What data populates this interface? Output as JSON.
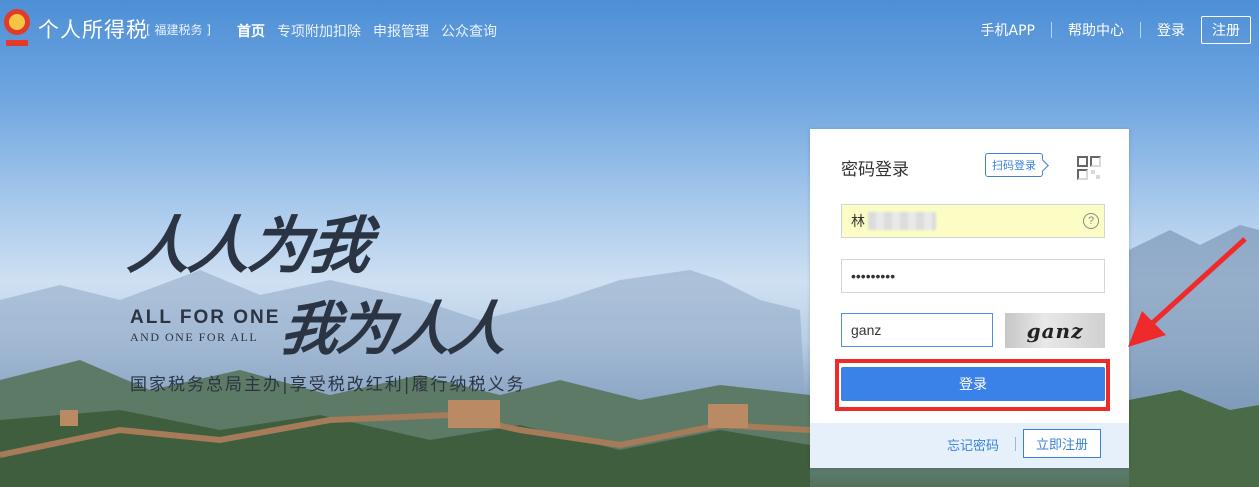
{
  "header": {
    "brand_title": "个人所得税",
    "brand_region": "[ 福建税务 ]",
    "nav": [
      {
        "label": "首页",
        "active": true
      },
      {
        "label": "专项附加扣除",
        "active": false
      },
      {
        "label": "申报管理",
        "active": false
      },
      {
        "label": "公众查询",
        "active": false
      }
    ],
    "right_links": {
      "mobile_app": "手机APP",
      "help_center": "帮助中心",
      "login": "登录",
      "register": "注册"
    }
  },
  "slogan": {
    "cn_line1": "人人为我",
    "en_line1": "ALL FOR ONE",
    "en_line2": "AND ONE FOR ALL",
    "cn_line2": "我为人人",
    "motto": "国家税务总局主办|享受税改红利|履行纳税义务"
  },
  "login_panel": {
    "title": "密码登录",
    "qr_tip": "扫码登录",
    "username_value": "林",
    "password_value": "•••••••••",
    "captcha_value": "ganz",
    "captcha_image_text": "ganz",
    "login_button": "登录",
    "forgot_password": "忘记密码",
    "register_now": "立即注册",
    "help_glyph": "?"
  },
  "colors": {
    "accent": "#3b82e8",
    "highlight": "#ee2a2a",
    "autofill_bg": "#fbfdc5"
  }
}
